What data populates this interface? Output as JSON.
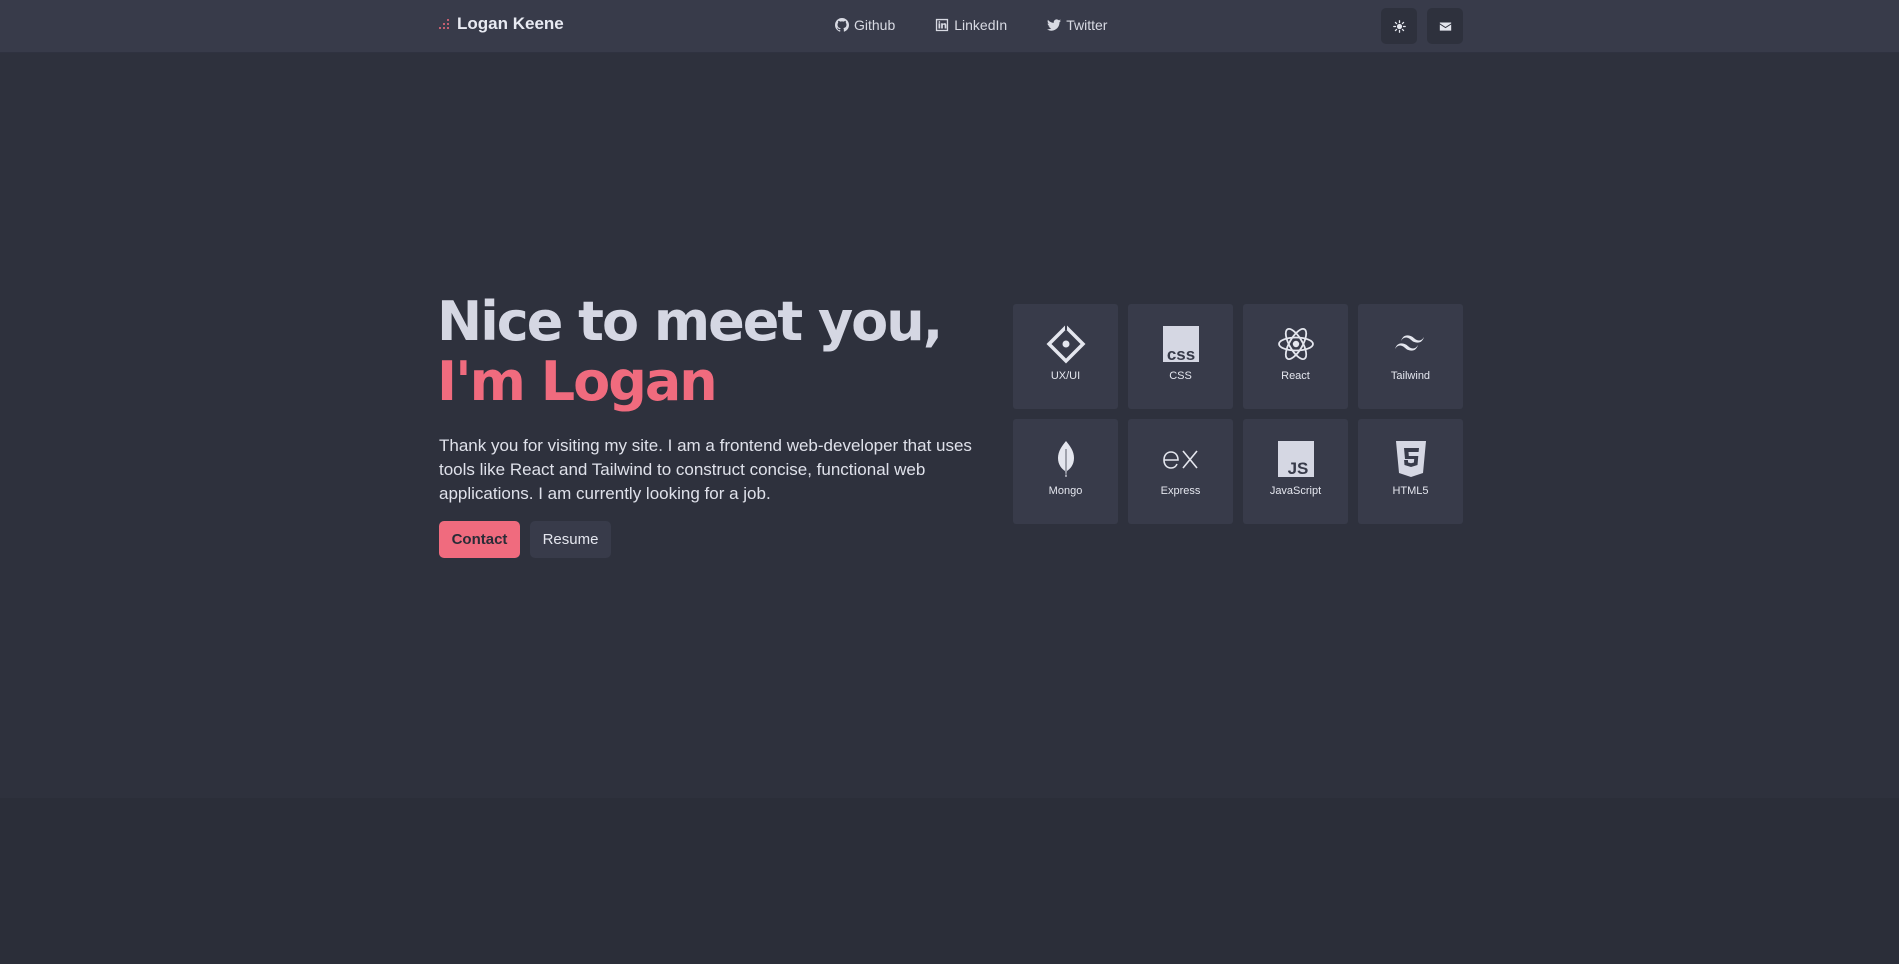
{
  "header": {
    "brand": "Logan Keene",
    "nav": [
      {
        "label": "Github",
        "icon": "github-icon"
      },
      {
        "label": "LinkedIn",
        "icon": "linkedin-icon"
      },
      {
        "label": "Twitter",
        "icon": "twitter-icon"
      }
    ],
    "actions": [
      {
        "icon": "theme-toggle-icon"
      },
      {
        "icon": "mail-icon"
      }
    ]
  },
  "hero": {
    "title_line1": "Nice to meet you,",
    "title_line2": "I'm Logan",
    "description": "Thank you for visiting my site. I am a frontend web-developer that uses tools like React and Tailwind to construct concise, functional web applications. I am currently looking for a job.",
    "contact_label": "Contact",
    "resume_label": "Resume"
  },
  "skills": [
    {
      "label": "UX/UI",
      "icon": "uxui-icon"
    },
    {
      "label": "CSS",
      "icon": "css-icon"
    },
    {
      "label": "React",
      "icon": "react-icon"
    },
    {
      "label": "Tailwind",
      "icon": "tailwind-icon"
    },
    {
      "label": "Mongo",
      "icon": "mongo-icon"
    },
    {
      "label": "Express",
      "icon": "express-icon"
    },
    {
      "label": "JavaScript",
      "icon": "javascript-icon"
    },
    {
      "label": "HTML5",
      "icon": "html5-icon"
    }
  ],
  "colors": {
    "background": "#2e313d",
    "header": "#383b4a",
    "accent": "#f06b7e",
    "text": "#d5d7e3"
  }
}
